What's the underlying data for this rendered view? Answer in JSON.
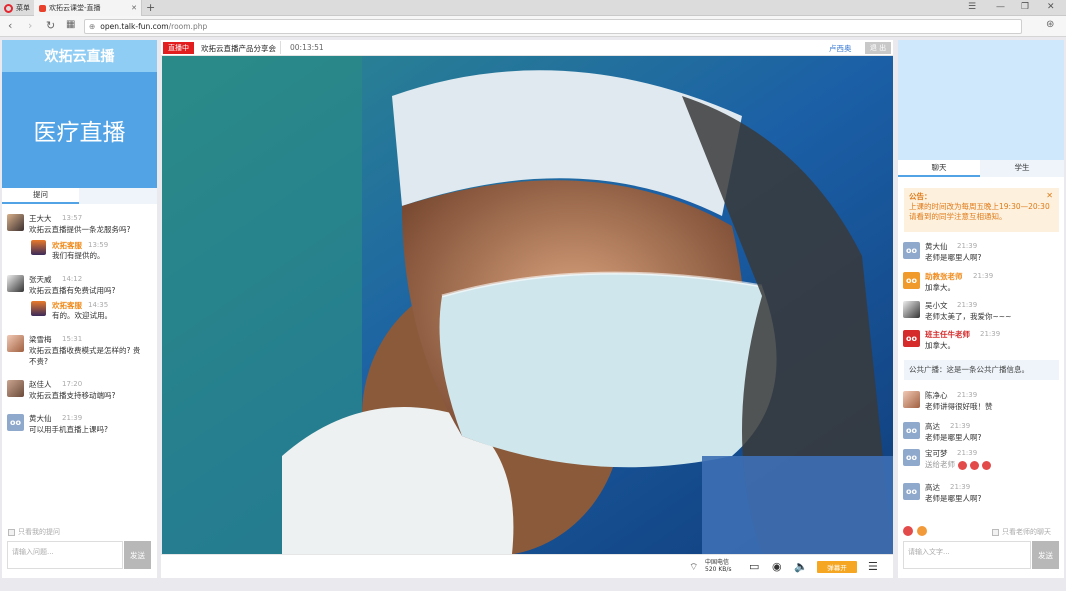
{
  "browser": {
    "menu_label": "菜单",
    "tab_title": "欢拓云课堂-直播",
    "url_host": "open.talk-fun.com",
    "url_path": "/room.php"
  },
  "left": {
    "brand": "欢拓云直播",
    "banner": "医疗直播",
    "tab_label": "提问",
    "messages": [
      {
        "name": "王大大",
        "time": "13:57",
        "text": "欢拓云直播提供一条龙服务吗?",
        "reply": {
          "name": "欢拓客服",
          "time": "13:59",
          "text": "我们有提供的。"
        }
      },
      {
        "name": "张天威",
        "time": "14:12",
        "text": "欢拓云直播有免费试用吗?",
        "reply": {
          "name": "欢拓客服",
          "time": "14:35",
          "text": "有的。欢迎试用。"
        }
      },
      {
        "name": "梁雪梅",
        "time": "15:31",
        "text": "欢拓云直播收费模式是怎样的? 贵",
        "text2": "不贵?"
      },
      {
        "name": "赵佳人",
        "time": "17:20",
        "text": "欢拓云直播支持移动端吗?"
      },
      {
        "name": "黄大仙",
        "time": "21:39",
        "text": "可以用手机直播上课吗?"
      }
    ],
    "only_mine": "只看我的提问",
    "input_placeholder": "请输入问题...",
    "send": "发送"
  },
  "center": {
    "live_badge": "直播中",
    "room_title": "欢拓云直播产品分享会",
    "elapsed": "00:13:51",
    "host": "卢西奥",
    "exit": "退 出",
    "network": "中国电信",
    "speed": "520 KB/s",
    "danmu": "弹幕开"
  },
  "right": {
    "tab_chat": "聊天",
    "tab_students": "学生",
    "notice_title": "公告：",
    "notice_line1": "上课的时间改为每周五晚上19:30—20:30",
    "notice_line2": "请看到的同学注意互相通知。",
    "messages": [
      {
        "name": "黄大仙",
        "time": "21:39",
        "text": "老师是哪里人啊?"
      },
      {
        "name": "助教张老师",
        "time": "21:39",
        "text": "加拿大。"
      },
      {
        "name": "吴小文",
        "time": "21:39",
        "text": "老师太美了，我爱你~~~"
      },
      {
        "name": "班主任牛老师",
        "time": "21:39",
        "text": "加拿大。"
      }
    ],
    "broadcast": "公共广播：这是一条公共广播信息。",
    "messages2": [
      {
        "name": "陈净心",
        "time": "21:39",
        "text": "老师讲得很好哦！赞"
      },
      {
        "name": "高达",
        "time": "21:39",
        "text": "老师是哪里人啊?"
      },
      {
        "name": "宝可梦",
        "time": "21:39",
        "text": "送给老师"
      },
      {
        "name": "高达",
        "time": "21:39",
        "text": "老师是哪里人啊?"
      }
    ],
    "only_teacher": "只看老师的聊天",
    "input_placeholder": "请输入文字...",
    "send": "发送"
  }
}
